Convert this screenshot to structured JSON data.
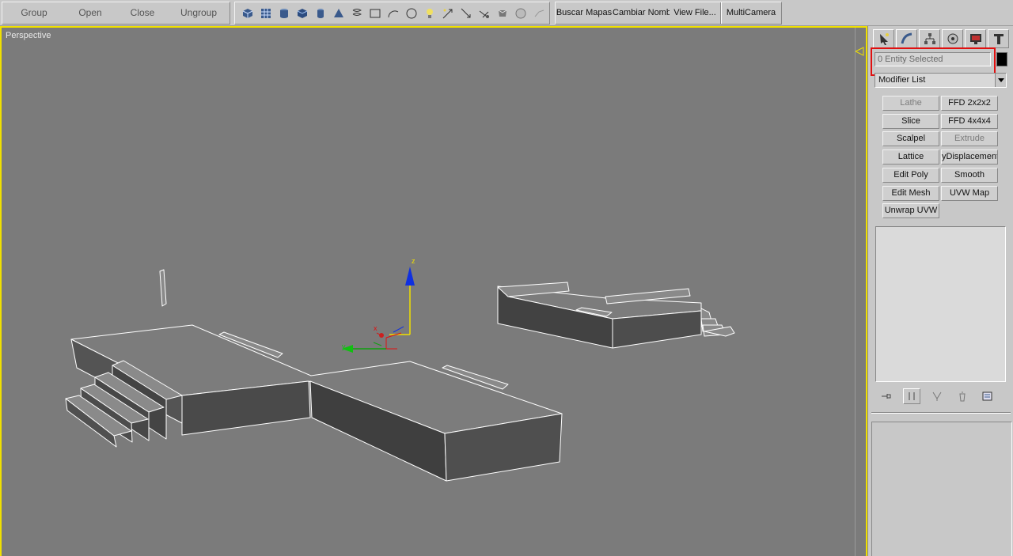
{
  "toolbar": {
    "group_label": "Group",
    "open_label": "Open",
    "close_label": "Close",
    "ungroup_label": "Ungroup",
    "icons": [
      "box-icon",
      "grid-icon",
      "cylinder-icon",
      "cube-icon",
      "tube-icon",
      "cone-icon",
      "helix-icon",
      "rectangle-icon",
      "arc-icon",
      "circle-icon",
      "light-icon",
      "camera-icon",
      "target-camera-icon",
      "spotlight-icon",
      "teapot-icon",
      "sphere-icon",
      "undo-arrow-icon"
    ],
    "buscar_label": "Buscar Mapas",
    "cambiar_label": "Cambiar Nombr",
    "viewfile_label": "View File...",
    "multicamera_label": "MultiCamera"
  },
  "viewport": {
    "label": "Perspective",
    "border_color": "#f0e000",
    "background": "#7b7b7b",
    "gizmo": {
      "x_label": "x",
      "y_label": "y",
      "z_label": "z"
    }
  },
  "panel": {
    "tabs": [
      "create-tab",
      "modify-tab",
      "hierarchy-tab",
      "motion-tab",
      "display-tab",
      "utilities-tab"
    ],
    "selection_text": "0 Entity Selected",
    "swatch_color": "#000000",
    "modifier_list_label": "Modifier List",
    "modifiers": [
      {
        "label": "Lathe",
        "enabled": false
      },
      {
        "label": "FFD 2x2x2",
        "enabled": true
      },
      {
        "label": "Slice",
        "enabled": true
      },
      {
        "label": "FFD 4x4x4",
        "enabled": true
      },
      {
        "label": "Scalpel",
        "enabled": true
      },
      {
        "label": "Extrude",
        "enabled": false
      },
      {
        "label": "Lattice",
        "enabled": true
      },
      {
        "label": "yDisplacement",
        "enabled": true
      },
      {
        "label": "Edit Poly",
        "enabled": true
      },
      {
        "label": "Smooth",
        "enabled": true
      },
      {
        "label": "Edit Mesh",
        "enabled": true
      },
      {
        "label": "UVW Map",
        "enabled": true
      },
      {
        "label": "Unwrap UVW",
        "enabled": true
      }
    ],
    "stack_tools": [
      "pin-stack-icon",
      "show-end-result-icon",
      "make-unique-icon",
      "remove-modifier-icon",
      "configure-sets-icon"
    ],
    "highlight_color": "#e01010"
  }
}
